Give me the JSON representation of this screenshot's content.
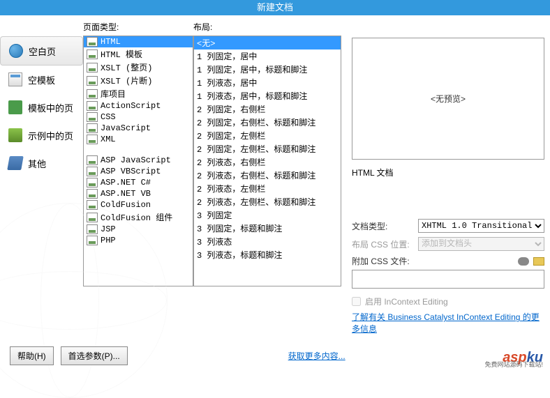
{
  "title": "新建文档",
  "left_nav": [
    {
      "label": "空白页",
      "icon": "blank"
    },
    {
      "label": "空模板",
      "icon": "template"
    },
    {
      "label": "模板中的页",
      "icon": "folder"
    },
    {
      "label": "示例中的页",
      "icon": "example"
    },
    {
      "label": "其他",
      "icon": "other"
    }
  ],
  "page_type": {
    "header": "页面类型:",
    "items": [
      "HTML",
      "HTML 模板",
      "XSLT (整页)",
      "XSLT (片断)",
      "库项目",
      "ActionScript",
      "CSS",
      "JavaScript",
      "XML",
      "",
      "ASP JavaScript",
      "ASP VBScript",
      "ASP.NET C#",
      "ASP.NET VB",
      "ColdFusion",
      "ColdFusion 组件",
      "JSP",
      "PHP"
    ]
  },
  "layout": {
    "header": "布局:",
    "items": [
      "<无>",
      "1 列固定，居中",
      "1 列固定，居中，标题和脚注",
      "1 列液态，居中",
      "1 列液态，居中，标题和脚注",
      "2 列固定，右侧栏",
      "2 列固定，右侧栏、标题和脚注",
      "2 列固定，左侧栏",
      "2 列固定，左侧栏、标题和脚注",
      "2 列液态，右侧栏",
      "2 列液态，右侧栏、标题和脚注",
      "2 列液态，左侧栏",
      "2 列液态，左侧栏、标题和脚注",
      "3 列固定",
      "3 列固定，标题和脚注",
      "3 列液态",
      "3 列液态，标题和脚注"
    ]
  },
  "preview": {
    "placeholder": "<无预览>",
    "description": "HTML 文档"
  },
  "form": {
    "doctype_label": "文档类型:",
    "doctype_value": "XHTML 1.0 Transitional",
    "css_layout_label": "布局 CSS 位置:",
    "css_layout_value": "添加到文档头",
    "css_attach_label": "附加 CSS 文件:",
    "incontext_label": "启用 InContext Editing",
    "info_link": "了解有关 Business Catalyst InContext Editing 的更多信息"
  },
  "footer": {
    "help": "帮助(H)",
    "prefs": "首选参数(P)...",
    "more_link": "获取更多内容..."
  },
  "watermark": {
    "brand_a": "asp",
    "brand_b": "ku",
    "sub": "免费网站源码下载站!"
  }
}
